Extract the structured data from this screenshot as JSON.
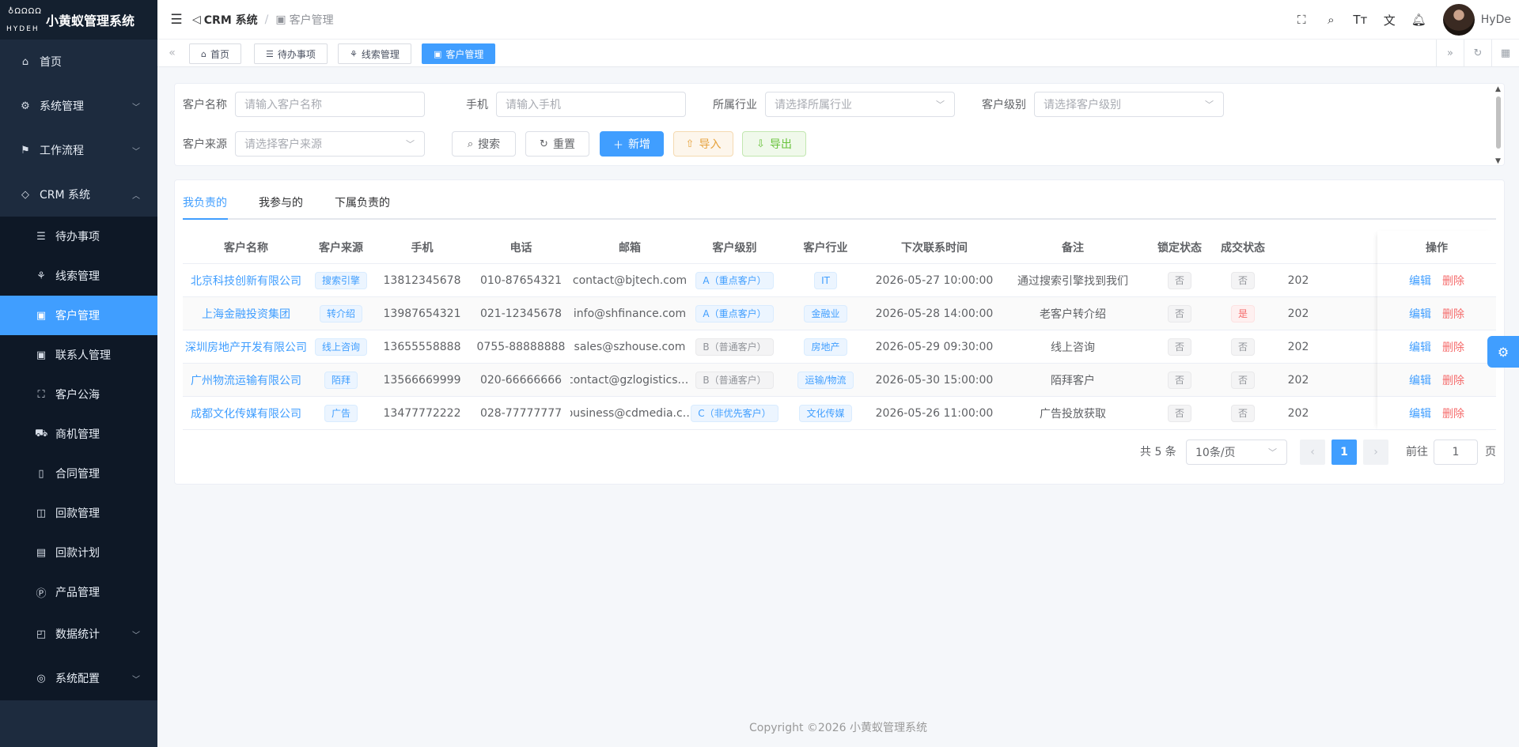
{
  "brand": {
    "logo_top": "♁ΩΩΩΩ",
    "logo_bottom": "HYDEH",
    "title": "小黄蚁管理系统"
  },
  "sidebar": {
    "items": [
      {
        "label": "首页",
        "icon": "home-icon",
        "glyph": "⌂"
      },
      {
        "label": "系统管理",
        "icon": "gear-icon",
        "glyph": "⚙"
      },
      {
        "label": "工作流程",
        "icon": "workflow-icon",
        "glyph": "⚑"
      },
      {
        "label": "CRM 系统",
        "icon": "crm-icon",
        "glyph": "◇"
      }
    ],
    "crm_sub": [
      {
        "label": "待办事项",
        "icon": "todo-list-icon",
        "glyph": "☰"
      },
      {
        "label": "线索管理",
        "icon": "clue-icon",
        "glyph": "⚘"
      },
      {
        "label": "客户管理",
        "icon": "customer-icon",
        "glyph": "▣"
      },
      {
        "label": "联系人管理",
        "icon": "contact-icon",
        "glyph": "▣"
      },
      {
        "label": "客户公海",
        "icon": "public-pool-icon",
        "glyph": "⛶"
      },
      {
        "label": "商机管理",
        "icon": "bus-icon",
        "glyph": "⛟"
      },
      {
        "label": "合同管理",
        "icon": "contract-icon",
        "glyph": "▯"
      },
      {
        "label": "回款管理",
        "icon": "payment-icon",
        "glyph": "◫"
      },
      {
        "label": "回款计划",
        "icon": "plan-icon",
        "glyph": "▤"
      },
      {
        "label": "产品管理",
        "icon": "product-icon",
        "glyph": "Ⓟ"
      },
      {
        "label": "数据统计",
        "icon": "stats-icon",
        "glyph": "◰"
      },
      {
        "label": "系统配置",
        "icon": "config-icon",
        "glyph": "◎"
      }
    ]
  },
  "header": {
    "breadcrumb_root": "CRM 系统",
    "breadcrumb_current": "客户管理",
    "user_name": "HyDe"
  },
  "tags": [
    {
      "label": "首页",
      "glyph": "⌂"
    },
    {
      "label": "待办事项",
      "glyph": "☰"
    },
    {
      "label": "线索管理",
      "glyph": "⚘"
    },
    {
      "label": "客户管理",
      "glyph": "▣"
    }
  ],
  "search": {
    "name_label": "客户名称",
    "name_placeholder": "请输入客户名称",
    "phone_label": "手机",
    "phone_placeholder": "请输入手机",
    "industry_label": "所属行业",
    "industry_placeholder": "请选择所属行业",
    "level_label": "客户级别",
    "level_placeholder": "请选择客户级别",
    "source_label": "客户来源",
    "source_placeholder": "请选择客户来源",
    "btn_search": "搜索",
    "btn_reset": "重置",
    "btn_add": "新增",
    "btn_import": "导入",
    "btn_export": "导出"
  },
  "tabs": [
    "我负责的",
    "我参与的",
    "下属负责的"
  ],
  "table": {
    "columns": [
      "客户名称",
      "客户来源",
      "手机",
      "电话",
      "邮箱",
      "客户级别",
      "客户行业",
      "下次联系时间",
      "备注",
      "锁定状态",
      "成交状态",
      "操作"
    ],
    "rows": [
      {
        "name": "北京科技创新有限公司",
        "source": "搜索引擎",
        "mobile": "13812345678",
        "phone": "010-87654321",
        "email": "contact@bjtech.com",
        "level": "A（重点客户）",
        "industry": "IT",
        "next": "2026-05-27 10:00:00",
        "remark": "通过搜索引擎找到我们",
        "lock": "否",
        "deal": "否",
        "extra": "202"
      },
      {
        "name": "上海金融投资集团",
        "source": "转介绍",
        "mobile": "13987654321",
        "phone": "021-12345678",
        "email": "info@shfinance.com",
        "level": "A（重点客户）",
        "industry": "金融业",
        "next": "2026-05-28 14:00:00",
        "remark": "老客户转介绍",
        "lock": "否",
        "deal": "是",
        "extra": "202"
      },
      {
        "name": "深圳房地产开发有限公司",
        "source": "线上咨询",
        "mobile": "13655558888",
        "phone": "0755-88888888",
        "email": "sales@szhouse.com",
        "level": "B（普通客户）",
        "industry": "房地产",
        "next": "2026-05-29 09:30:00",
        "remark": "线上咨询",
        "lock": "否",
        "deal": "否",
        "extra": "202"
      },
      {
        "name": "广州物流运输有限公司",
        "source": "陌拜",
        "mobile": "13566669999",
        "phone": "020-66666666",
        "email": "contact@gzlogistics.…",
        "level": "B（普通客户）",
        "industry": "运输/物流",
        "next": "2026-05-30 15:00:00",
        "remark": "陌拜客户",
        "lock": "否",
        "deal": "否",
        "extra": "202"
      },
      {
        "name": "成都文化传媒有限公司",
        "source": "广告",
        "mobile": "13477772222",
        "phone": "028-77777777",
        "email": "business@cdmedia.c…",
        "level": "C（非优先客户）",
        "industry": "文化传媒",
        "next": "2026-05-26 11:00:00",
        "remark": "广告投放获取",
        "lock": "否",
        "deal": "否",
        "extra": "202"
      }
    ],
    "op_edit": "编辑",
    "op_delete": "删除"
  },
  "pagination": {
    "total": "共 5 条",
    "page_size": "10条/页",
    "current": "1",
    "goto": "前往",
    "goto_value": "1",
    "page_unit": "页"
  },
  "footer": "Copyright ©2026 小黄蚁管理系统",
  "colors": {
    "primary": "#409eff",
    "sidebar_bg": "#1d2b3e",
    "danger": "#f56c6c"
  }
}
